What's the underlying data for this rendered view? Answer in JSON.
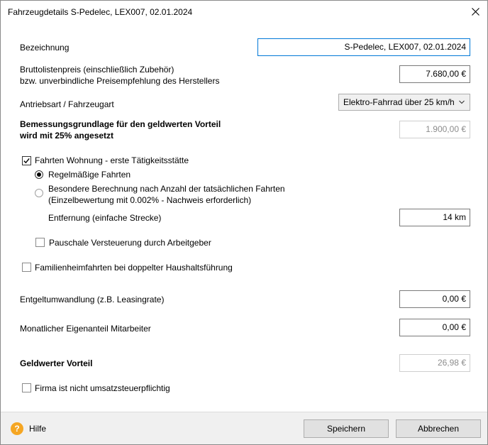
{
  "window": {
    "title": "Fahrzeugdetails S-Pedelec, LEX007, 02.01.2024"
  },
  "form": {
    "bezeichnung_label": "Bezeichnung",
    "bezeichnung_value": "S-Pedelec, LEX007, 02.01.2024",
    "bruttolistenpreis_label_1": "Bruttolistenpreis (einschließlich Zubehör)",
    "bruttolistenpreis_label_2": "bzw. unverbindliche Preisempfehlung des Herstellers",
    "bruttolistenpreis_value": "7.680,00 €",
    "antriebsart_label": "Antriebsart / Fahrzeugart",
    "antriebsart_value": "Elektro-Fahrrad über 25 km/h",
    "bemessung_label_1": "Bemessungsgrundlage für den geldwerten Vorteil",
    "bemessung_label_2": "wird mit 25% angesetzt",
    "bemessung_value": "1.900,00 €",
    "fahrten_label": "Fahrten Wohnung - erste Tätigkeitsstätte",
    "fahrten_checked": true,
    "regelmaessig_label": "Regelmäßige Fahrten",
    "besondere_label_1": "Besondere Berechnung nach Anzahl der tatsächlichen Fahrten",
    "besondere_label_2": "(Einzelbewertung mit 0.002% - Nachweis erforderlich)",
    "entfernung_label": "Entfernung (einfache Strecke)",
    "entfernung_value": "14 km",
    "pauschale_label": "Pauschale Versteuerung durch Arbeitgeber",
    "pauschale_checked": false,
    "familienheim_label": "Familienheimfahrten bei doppelter Haushaltsführung",
    "familienheim_checked": false,
    "entgelt_label": "Entgeltumwandlung (z.B. Leasingrate)",
    "entgelt_value": "0,00 €",
    "eigenanteil_label": "Monatlicher Eigenanteil Mitarbeiter",
    "eigenanteil_value": "0,00 €",
    "geldwert_label": "Geldwerter Vorteil",
    "geldwert_value": "26,98 €",
    "firma_label": "Firma ist nicht umsatzsteuerpflichtig",
    "firma_checked": false
  },
  "footer": {
    "help_label": "Hilfe",
    "save_label": "Speichern",
    "cancel_label": "Abbrechen"
  },
  "colors": {
    "help_icon": "#f5a623",
    "focus_border": "#0078d7",
    "footer_bg": "#f0f0f0"
  }
}
